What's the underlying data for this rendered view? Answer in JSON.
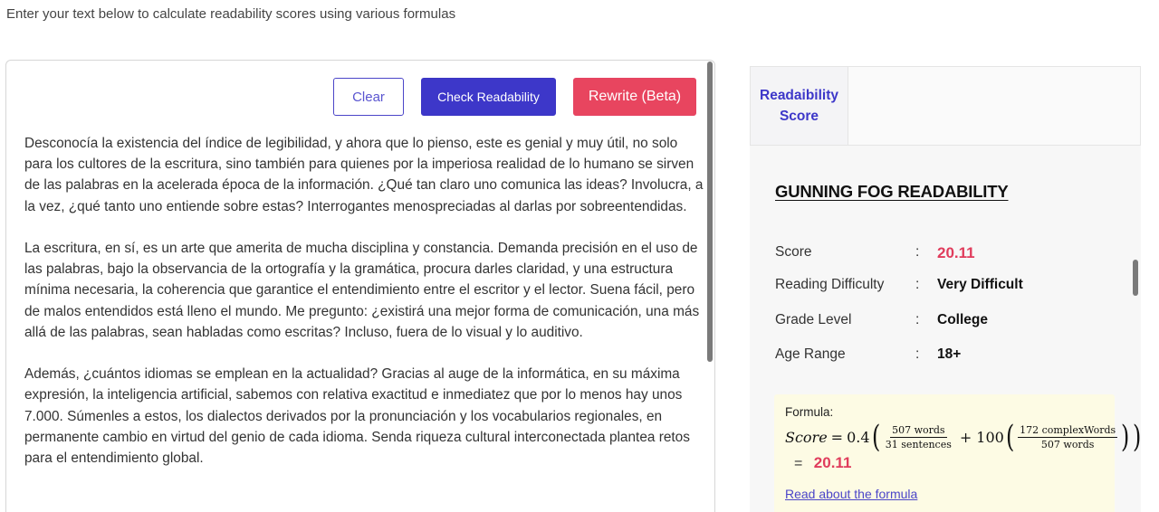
{
  "intro_text": "Enter your text below to calculate readability scores using various formulas",
  "toolbar": {
    "clear_label": "Clear",
    "check_label": "Check Readability",
    "rewrite_label": "Rewrite (Beta)"
  },
  "editor": {
    "paragraphs": [
      "Desconocía la existencia del índice de legibilidad, y ahora que lo pienso, este es genial y muy útil, no solo para los cultores de la escritura, sino también para quienes por la imperiosa realidad de lo humano se sirven de las palabras en la acelerada época de la información. ¿Qué tan claro uno comunica las ideas? Involucra, a la vez, ¿qué tanto uno entiende sobre estas? Interrogantes menospreciadas al darlas por sobreentendidas.",
      "La escritura, en sí, es un arte que amerita de mucha disciplina y constancia. Demanda precisión en el uso de las palabras, bajo la observancia de la ortografía y la gramática, procura darles claridad, y una estructura mínima necesaria, la coherencia que garantice el entendimiento entre el escritor y el lector. Suena fácil, pero de malos entendidos está lleno el mundo. Me pregunto: ¿existirá una mejor forma de comunicación, una más allá de las palabras, sean habladas como escritas? Incluso, fuera de lo visual y lo auditivo.",
      "Además, ¿cuántos idiomas se emplean en la actualidad? Gracias al auge de la informática, en su máxima expresión, la inteligencia artificial, sabemos con relativa exactitud e inmediatez que por lo menos hay unos 7.000. Súmenles a estos, los dialectos derivados por la pronunciación y los vocabularios regionales, en permanente cambio en virtud del genio de cada idioma. Senda riqueza cultural interconectada plantea retos para el entendimiento global."
    ]
  },
  "tabs": {
    "active_label": "Readaibility Score"
  },
  "results": {
    "heading": "GUNNING FOG READABILITY",
    "separator": ":",
    "rows": [
      {
        "label": "Score",
        "value": "20.11"
      },
      {
        "label": "Reading Difficulty",
        "value": "Very Difficult"
      },
      {
        "label": "Grade Level",
        "value": "College"
      },
      {
        "label": "Age Range",
        "value": "18+"
      }
    ]
  },
  "formula": {
    "title": "Formula:",
    "score_var": "Score",
    "equals": "=",
    "coef1": "0.4",
    "frac1_num": "507 words",
    "frac1_den": "31 sentences",
    "plus": "+",
    "coef2": "100",
    "frac2_num": "172 complexWords",
    "frac2_den": "507 words",
    "result_eq": "=",
    "result": "20.11",
    "link_label": "Read about the formula"
  },
  "colors": {
    "primary": "#3d37c9",
    "danger": "#e8455f",
    "score": "#e03c5c",
    "formula_bg": "#fdfbe4"
  }
}
